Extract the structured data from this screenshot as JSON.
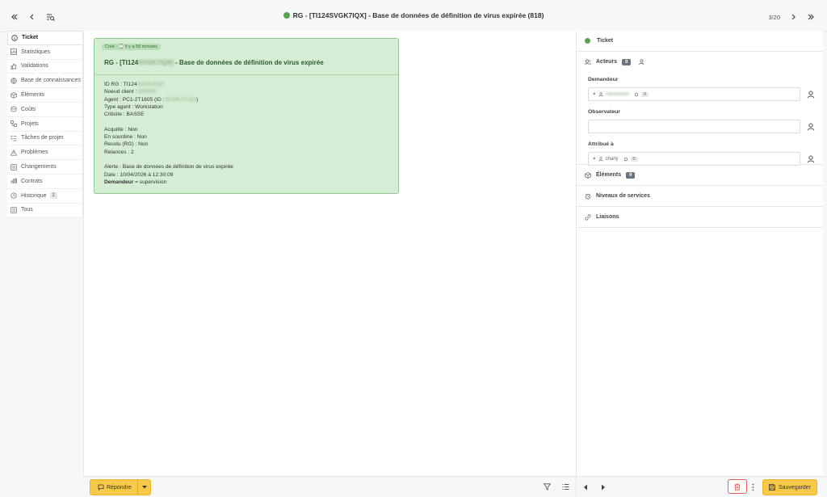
{
  "topbar": {
    "title": "RG - [TI124SVGK7IQX] - Base de données de définition de virus expirée (818)",
    "status_color": "#5aa157",
    "pager": "3/20",
    "icons": [
      "double-chevron-left-icon",
      "chevron-left-icon",
      "list-search-icon",
      "chevron-right-icon",
      "double-chevron-right-icon"
    ]
  },
  "nav": {
    "items": [
      {
        "label": "Ticket",
        "icon": "info-icon",
        "active": true
      },
      {
        "label": "Statistiques",
        "icon": "chart-icon"
      },
      {
        "label": "Validations",
        "icon": "thumb-up-icon"
      },
      {
        "label": "Base de connaissances",
        "icon": "globe-icon"
      },
      {
        "label": "Éléments",
        "icon": "box-icon"
      },
      {
        "label": "Coûts",
        "icon": "coin-icon"
      },
      {
        "label": "Projets",
        "icon": "projects-icon"
      },
      {
        "label": "Tâches de projet",
        "icon": "tasks-icon"
      },
      {
        "label": "Problèmes",
        "icon": "warning-icon"
      },
      {
        "label": "Changements",
        "icon": "changes-icon"
      },
      {
        "label": "Contrats",
        "icon": "contracts-icon"
      },
      {
        "label": "Historique",
        "icon": "history-icon",
        "badge": "2"
      },
      {
        "label": "Tous",
        "icon": "all-icon"
      }
    ]
  },
  "alert": {
    "tag": "Créé : ⌚ Il y a 58 minutes",
    "title_prefix": "RG - [TI124",
    "title_blur": "SVGK7IQX]",
    "title_suffix": " - Base de données de définition de virus expirée",
    "lines": {
      "id_label": "ID RG : TI124",
      "id_blur": "SVGK7IQX",
      "node_label": "Noeud client : ",
      "node_blur": "000000",
      "agent_label": "Agent : PC1-2T1605 (ID : ",
      "agent_blur": "8Y1R-2T-QX",
      "agent_end": ")",
      "type": "Type agent : Workstation",
      "crit": "Criticite : BASSE",
      "ack": "Acquitte : Non",
      "mute": "En sourdine : Non",
      "resolved": "Resolu (RG) : Non",
      "relances": "Relances : 2",
      "alerte": "Alerte : Base de données de définition de virus expirée",
      "date": "Date : 10/04/2026 à 12:30:09",
      "demandeur_bold": "Demandeur",
      "demandeur_rest": " = supervision"
    },
    "bg_color": "#d4edd4"
  },
  "right": {
    "ticket": "Ticket",
    "acteurs": "Acteurs",
    "acteurs_count": "0",
    "demandeur_label": "Demandeur",
    "demandeur_chip": "Valorolaine",
    "demandeur_n": "0",
    "observateur_label": "Observateur",
    "attribue_label": "Attribué à",
    "attribue_chip": "charly",
    "attribue_n": "0",
    "elements": "Éléments",
    "elements_count": "0",
    "niveaux": "Niveaux de services",
    "liaisons": "Liaisons"
  },
  "bottom": {
    "reply": "Répondre",
    "save": "Sauvegarder",
    "accent": "#f7c948",
    "danger": "#e26060"
  }
}
